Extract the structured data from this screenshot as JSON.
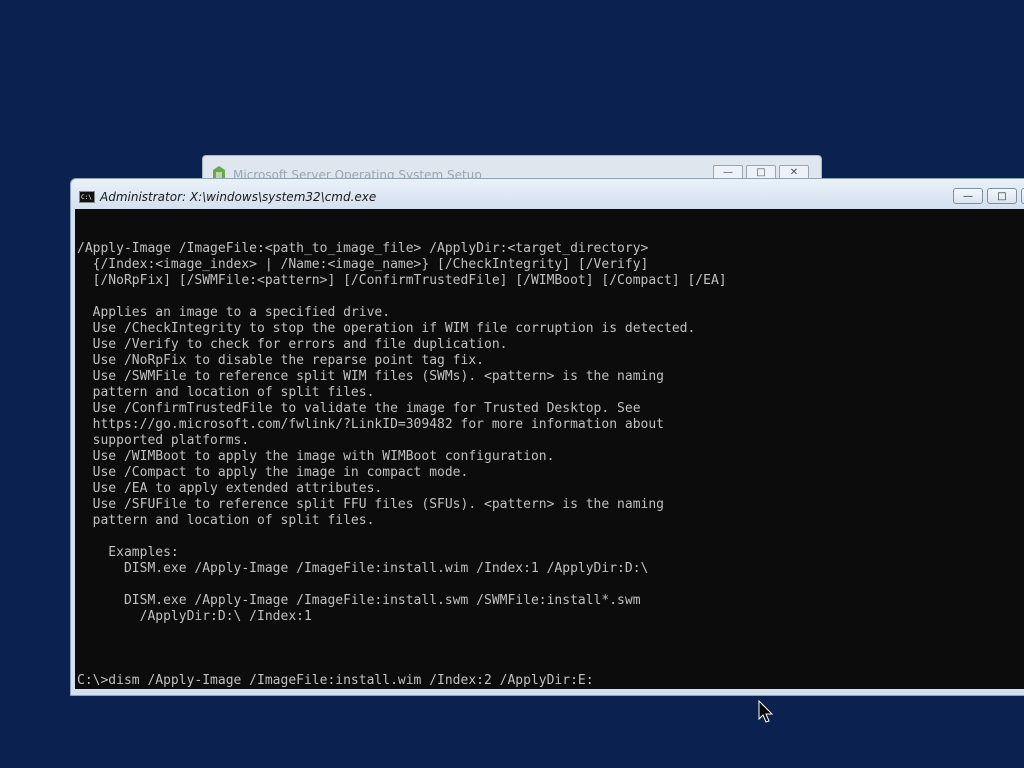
{
  "setup_window": {
    "title": "Microsoft Server Operating System Setup",
    "buttons": [
      "—",
      "□",
      "✕"
    ]
  },
  "cmd_window": {
    "title": "Administrator: X:\\windows\\system32\\cmd.exe",
    "icon_label": "C:\\",
    "buttons": {
      "minimize": "—",
      "maximize": "□",
      "close": "✕"
    }
  },
  "console": {
    "lines": [
      "/Apply-Image /ImageFile:<path_to_image_file> /ApplyDir:<target_directory>",
      "  {/Index:<image_index> | /Name:<image_name>} [/CheckIntegrity] [/Verify]",
      "  [/NoRpFix] [/SWMFile:<pattern>] [/ConfirmTrustedFile] [/WIMBoot] [/Compact] [/EA]",
      "",
      "  Applies an image to a specified drive.",
      "  Use /CheckIntegrity to stop the operation if WIM file corruption is detected.",
      "  Use /Verify to check for errors and file duplication.",
      "  Use /NoRpFix to disable the reparse point tag fix.",
      "  Use /SWMFile to reference split WIM files (SWMs). <pattern> is the naming",
      "  pattern and location of split files.",
      "  Use /ConfirmTrustedFile to validate the image for Trusted Desktop. See",
      "  https://go.microsoft.com/fwlink/?LinkID=309482 for more information about",
      "  supported platforms.",
      "  Use /WIMBoot to apply the image with WIMBoot configuration.",
      "  Use /Compact to apply the image in compact mode.",
      "  Use /EA to apply extended attributes.",
      "  Use /SFUFile to reference split FFU files (SFUs). <pattern> is the naming",
      "  pattern and location of split files.",
      "",
      "    Examples:",
      "      DISM.exe /Apply-Image /ImageFile:install.wim /Index:1 /ApplyDir:D:\\",
      "",
      "      DISM.exe /Apply-Image /ImageFile:install.swm /SWMFile:install*.swm",
      "        /ApplyDir:D:\\ /Index:1",
      "",
      "",
      "",
      "C:\\>dism /Apply-Image /ImageFile:install.wim /Index:2 /ApplyDir:E:"
    ]
  }
}
